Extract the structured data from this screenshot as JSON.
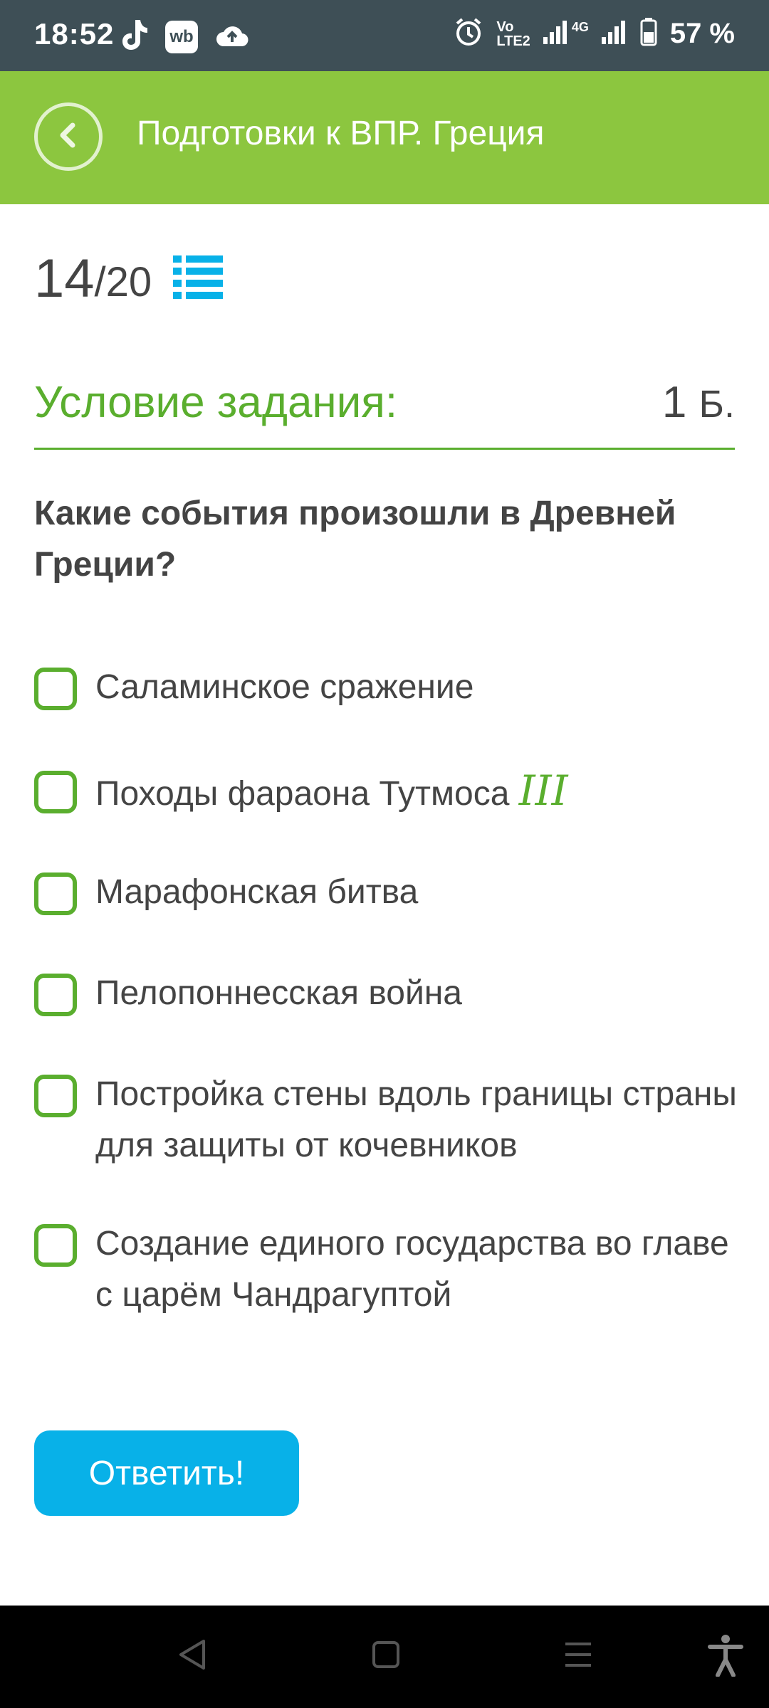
{
  "status_bar": {
    "time": "18:52",
    "left_icons": [
      "tiktok-icon",
      "wb-icon",
      "cloud-upload-icon"
    ],
    "wb_label": "wb",
    "lte_label_1": "Vo",
    "lte_label_2": "LTE2",
    "network_label": "4G",
    "battery_percent": "57 %"
  },
  "app_bar": {
    "title": "Подготовки к ВПР. Греция",
    "back_icon": "chevron-left-icon",
    "color": "#8cc63f"
  },
  "progress": {
    "current": "14",
    "separator": "/",
    "total": "20",
    "icon": "list-icon"
  },
  "condition": {
    "title": "Условие задания:",
    "points": "1",
    "points_unit": "Б."
  },
  "question": "Какие события произошли в Древней Греции?",
  "options": [
    {
      "label": "Саламинское сражение",
      "checked": false
    },
    {
      "label": "Походы фараона Тутмоса ",
      "suffix": "III",
      "checked": false
    },
    {
      "label": "Марафонская битва",
      "checked": false
    },
    {
      "label": "Пелопоннесская война",
      "checked": false
    },
    {
      "label": "Постройка стены вдоль границы страны для защиты от кочевников",
      "checked": false
    },
    {
      "label": "Создание единого государства во главе с царём Чандрагуптой",
      "checked": false
    }
  ],
  "answer_button": {
    "label": "Ответить!",
    "color": "#08b1e8"
  },
  "nav_bar": {
    "icons": [
      "back-triangle-icon",
      "home-square-icon",
      "recents-icon",
      "accessibility-icon"
    ]
  },
  "colors": {
    "accent_green": "#5aae2e",
    "status_bar": "#3e4f56",
    "text": "#444444"
  }
}
